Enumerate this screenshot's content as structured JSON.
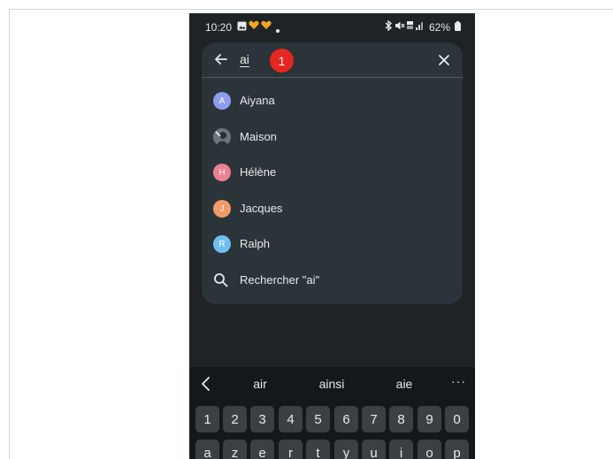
{
  "status_bar": {
    "time": "10:20",
    "battery": "62%",
    "left_icons": [
      "gallery-icon",
      "heart-icon",
      "heart-icon",
      "dot-icon"
    ],
    "right_icons": [
      "bluetooth-icon",
      "mute-icon",
      "signal-icon",
      "battery-icon"
    ]
  },
  "search": {
    "query": "ai",
    "badge": "1"
  },
  "contacts": [
    {
      "initial": "A",
      "name": "Aiyana",
      "color": "#8e9cf0"
    },
    {
      "initial": "",
      "name": "Maison",
      "color": "#5a6266",
      "photo": true
    },
    {
      "initial": "H",
      "name": "Hélène",
      "color": "#ef7f91"
    },
    {
      "initial": "J",
      "name": "Jacques",
      "color": "#f39a67"
    },
    {
      "initial": "R",
      "name": "Ralph",
      "color": "#6fbff0"
    }
  ],
  "search_suggestion": "Rechercher \"ai\"",
  "keyboard": {
    "suggestions": [
      "air",
      "ainsi",
      "aie"
    ],
    "more": "···",
    "number_row": [
      "1",
      "2",
      "3",
      "4",
      "5",
      "6",
      "7",
      "8",
      "9",
      "0"
    ],
    "letter_row": [
      "a",
      "z",
      "e",
      "r",
      "t",
      "y",
      "u",
      "i",
      "o",
      "p"
    ]
  },
  "colors": {
    "background": "#1e2326",
    "card": "#2b3438",
    "keyboard": "#14181a",
    "key": "#3a4043",
    "badge": "#e8261f"
  }
}
